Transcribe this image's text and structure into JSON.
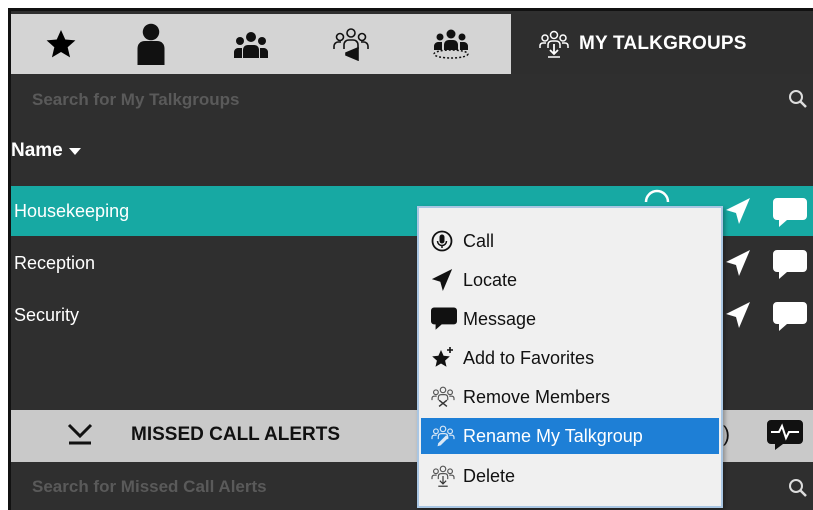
{
  "tabs": {
    "items": [
      {
        "name": "favorites-tab",
        "icon": "star-icon"
      },
      {
        "name": "contacts-tab",
        "icon": "person-icon"
      },
      {
        "name": "groups-tab",
        "icon": "group-icon"
      },
      {
        "name": "broadcast-groups-tab",
        "icon": "broadcast-group-icon"
      },
      {
        "name": "dynamic-groups-tab",
        "icon": "dynamic-group-icon"
      }
    ],
    "active_label": "MY TALKGROUPS"
  },
  "search": {
    "placeholder": "Search for My Talkgroups"
  },
  "list": {
    "column_header": "Name",
    "rows": [
      {
        "label": "Housekeeping",
        "selected": true
      },
      {
        "label": "Reception",
        "selected": false
      },
      {
        "label": "Security",
        "selected": false
      }
    ]
  },
  "alerts": {
    "title": "MISSED CALL ALERTS",
    "partial_text": ")",
    "search_placeholder": "Search for Missed Call Alerts"
  },
  "context_menu": {
    "items": [
      {
        "label": "Call",
        "icon": "microphone-icon"
      },
      {
        "label": "Locate",
        "icon": "locate-arrow-icon"
      },
      {
        "label": "Message",
        "icon": "message-bubble-icon"
      },
      {
        "label": "Add to Favorites",
        "icon": "add-star-icon"
      },
      {
        "label": "Remove Members",
        "icon": "remove-members-icon"
      },
      {
        "label": "Rename My Talkgroup",
        "icon": "rename-talkgroup-icon",
        "highlighted": true
      },
      {
        "label": "Delete",
        "icon": "delete-talkgroup-icon"
      }
    ]
  },
  "colors": {
    "selected_row": "#17a9a3",
    "menu_highlight": "#1e7fd6",
    "background": "#2f2f2f"
  }
}
